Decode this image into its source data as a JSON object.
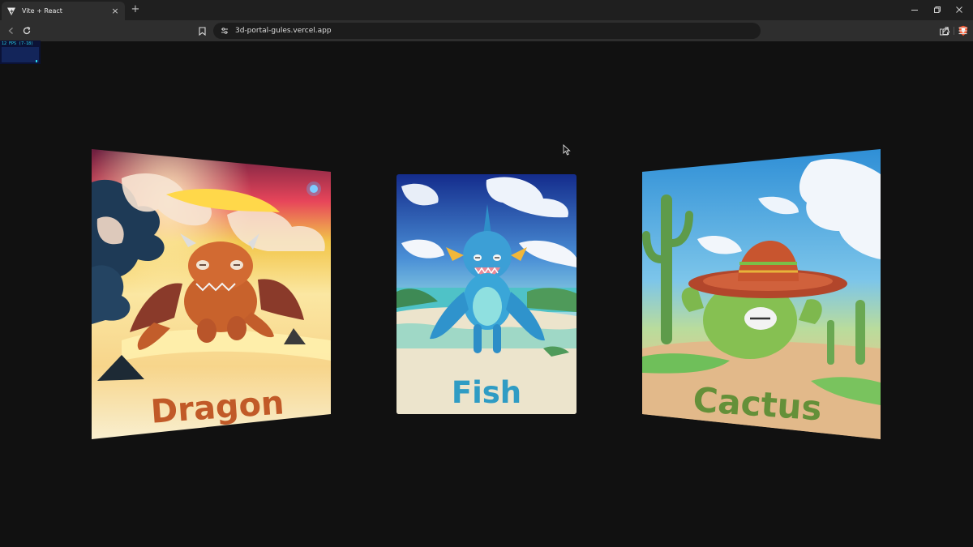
{
  "browser": {
    "tab_title": "Vite + React",
    "tab_close": "×",
    "new_tab": "+",
    "url": "3d-portal-gules.vercel.app"
  },
  "stats": {
    "label": "12 FPS (7-18)"
  },
  "portals": [
    {
      "title": "Dragon",
      "title_color": "#c15a28"
    },
    {
      "title": "Fish",
      "title_color": "#2f9cc4"
    },
    {
      "title": "Cactus",
      "title_color": "#4f8a2c"
    }
  ],
  "colors": {
    "page_background": "#111111",
    "tabbar": "#1f1f1f",
    "toolbar": "#2e2e2e",
    "brave_orange": "#fb542b"
  }
}
